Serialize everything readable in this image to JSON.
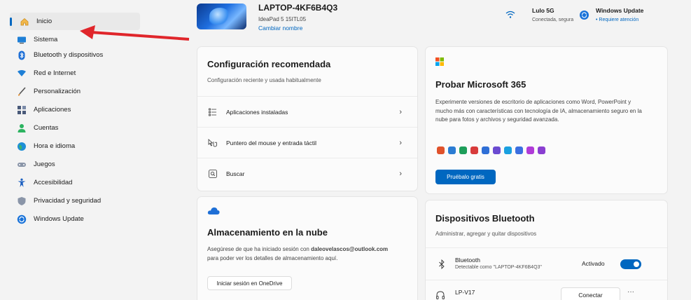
{
  "sidebar": {
    "items": [
      {
        "label": "Inicio",
        "icon": "home-icon",
        "active": true
      },
      {
        "label": "Sistema",
        "icon": "system-icon"
      },
      {
        "label": "Bluetooth y dispositivos",
        "icon": "bluetooth-icon"
      },
      {
        "label": "Red e Internet",
        "icon": "network-icon"
      },
      {
        "label": "Personalización",
        "icon": "brush-icon"
      },
      {
        "label": "Aplicaciones",
        "icon": "apps-icon"
      },
      {
        "label": "Cuentas",
        "icon": "account-icon"
      },
      {
        "label": "Hora e idioma",
        "icon": "globe-icon"
      },
      {
        "label": "Juegos",
        "icon": "gamepad-icon"
      },
      {
        "label": "Accesibilidad",
        "icon": "accessibility-icon"
      },
      {
        "label": "Privacidad y seguridad",
        "icon": "shield-icon"
      },
      {
        "label": "Windows Update",
        "icon": "update-icon"
      }
    ]
  },
  "device": {
    "name": "LAPTOP-4KF6B4Q3",
    "model": "IdeaPad 5 15ITL05",
    "rename": "Cambiar nombre"
  },
  "status": {
    "wifi_name": "Lulo 5G",
    "wifi_status": "Conectada, segura",
    "update_title": "Windows Update",
    "update_status": "• Requiere atención"
  },
  "recommended": {
    "title": "Configuración recomendada",
    "subtitle": "Configuración reciente y usada habitualmente",
    "rows": [
      {
        "label": "Aplicaciones instaladas",
        "icon": "list-icon"
      },
      {
        "label": "Puntero del mouse y entrada táctil",
        "icon": "pointer-icon"
      },
      {
        "label": "Buscar",
        "icon": "search-icon"
      }
    ]
  },
  "m365": {
    "title": "Probar Microsoft 365",
    "body": "Experimente versiones de escritorio de aplicaciones como Word, PowerPoint y mucho más con características con tecnología de IA, almacenamiento seguro en la nube para fotos y archivos y seguridad avanzada.",
    "button": "Pruébalo gratis",
    "app_colors": [
      "#e0522b",
      "#2b7cd3",
      "#1e9e5a",
      "#d83b3b",
      "#2f6fd6",
      "#6b4bd1",
      "#1aa0e0",
      "#3b6fe0",
      "#b03bd8",
      "#8a3fd1"
    ]
  },
  "cloud": {
    "title": "Almacenamiento en la nube",
    "body_prefix": "Asegúrese de que ha iniciado sesión con ",
    "email": "daleovelascos@outlook.com",
    "body_suffix": "para poder ver los detalles de almacenamiento aquí.",
    "button": "Iniciar sesión en OneDrive"
  },
  "bluetooth": {
    "title": "Dispositivos Bluetooth",
    "subtitle": "Administrar, agregar y quitar dispositivos",
    "bt_label": "Bluetooth",
    "bt_sub": "Detectable como \"LAPTOP-4KF6B4Q3\"",
    "bt_state": "Activado",
    "device_name": "LP-V17",
    "device_button": "Conectar",
    "more": "···"
  },
  "colors": {
    "accent": "#0067c0",
    "arrow": "#e0262b"
  }
}
